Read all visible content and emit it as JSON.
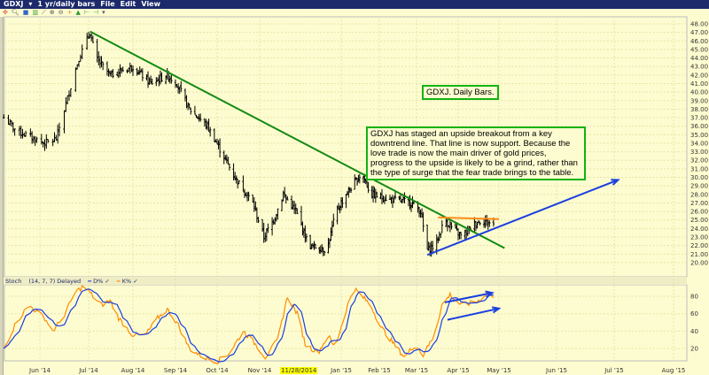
{
  "titlebar": {
    "symbol": "GDXJ",
    "period": "1 yr/daily bars",
    "menu": [
      "File",
      "Edit",
      "View"
    ]
  },
  "notes": {
    "title": "GDXJ. Daily Bars.",
    "comment": "GDXJ has staged an upside breakout from a key downtrend line. That line is now support.  Because the love trade is now the main driver of gold prices, progress to the upside is likely to be a grind, rather than the type of surge that the fear trade brings to the table."
  },
  "stoch_legend": {
    "name": "Stoch",
    "params": "(14, 7, 7) Delayed",
    "d_label": "D%",
    "k_label": "K%"
  },
  "highlight_date": "11/28/2014",
  "colors": {
    "bars": "#000000",
    "downtrend": "#138a13",
    "support": "#1a3ee0",
    "resistance": "#ff8c1a",
    "k": "#ff8c00",
    "d": "#1a3ee0"
  },
  "chart_data": [
    {
      "type": "ohlc",
      "title": "GDXJ daily bars",
      "ylim": [
        20,
        48
      ],
      "yticks": [
        "48.00",
        "47.00",
        "46.00",
        "45.00",
        "44.00",
        "43.00",
        "42.00",
        "41.00",
        "40.00",
        "39.00",
        "38.00",
        "37.00",
        "36.00",
        "35.00",
        "34.00",
        "33.00",
        "32.00",
        "31.00",
        "30.00",
        "29.00",
        "28.00",
        "27.00",
        "26.00",
        "25.00",
        "24.00",
        "23.00",
        "22.00",
        "21.00",
        "20.00"
      ],
      "xticks": [
        "Jun '14",
        "Jul '14",
        "Aug '14",
        "Sep '14",
        "Oct '14",
        "Nov '14",
        "Jan '15",
        "Feb '15",
        "Mar '15",
        "Apr '15",
        "May '15",
        "Jun '15",
        "Jul '15",
        "Aug '15"
      ],
      "close_keypoints": [
        [
          "2014-05-09",
          37
        ],
        [
          "2014-05-17",
          35.5
        ],
        [
          "2014-06-04",
          34
        ],
        [
          "2014-06-11",
          34.5
        ],
        [
          "2014-06-19",
          40
        ],
        [
          "2014-06-25",
          44
        ],
        [
          "2014-07-02",
          47
        ],
        [
          "2014-07-06",
          44
        ],
        [
          "2014-07-16",
          42
        ],
        [
          "2014-08-01",
          43
        ],
        [
          "2014-08-14",
          41
        ],
        [
          "2014-08-26",
          42
        ],
        [
          "2014-09-02",
          41
        ],
        [
          "2014-09-11",
          38
        ],
        [
          "2014-09-24",
          36
        ],
        [
          "2014-10-04",
          33
        ],
        [
          "2014-10-14",
          30
        ],
        [
          "2014-10-27",
          27
        ],
        [
          "2014-11-04",
          23
        ],
        [
          "2014-11-11",
          25
        ],
        [
          "2014-11-18",
          28
        ],
        [
          "2014-11-27",
          26
        ],
        [
          "2014-12-07",
          22
        ],
        [
          "2014-12-21",
          21.5
        ],
        [
          "2014-12-28",
          26
        ],
        [
          "2015-01-05",
          28
        ],
        [
          "2015-01-18",
          30.5
        ],
        [
          "2015-01-25",
          28
        ],
        [
          "2015-02-07",
          27.5
        ],
        [
          "2015-02-26",
          27
        ],
        [
          "2015-03-04",
          26
        ],
        [
          "2015-03-09",
          21.5
        ],
        [
          "2015-03-15",
          22
        ],
        [
          "2015-03-22",
          25
        ],
        [
          "2015-03-28",
          24
        ],
        [
          "2015-04-04",
          23
        ],
        [
          "2015-04-12",
          24.5
        ],
        [
          "2015-04-19",
          25
        ],
        [
          "2015-04-27",
          24.5
        ]
      ],
      "lines": [
        {
          "name": "downtrend",
          "from": [
            "2014-07-02",
            47.1
          ],
          "to": [
            "2015-05-04",
            21.7
          ]
        },
        {
          "name": "support",
          "from": [
            "2015-03-09",
            20.9
          ],
          "to": [
            "2015-07-03",
            29.7
          ],
          "arrow": true
        },
        {
          "name": "resistance",
          "from": [
            "2015-03-17",
            25.3
          ],
          "to": [
            "2015-05-01",
            25.1
          ]
        }
      ]
    },
    {
      "type": "line",
      "title": "Stoch (14, 7, 7) Delayed",
      "ylim": [
        0,
        100
      ],
      "yticks": [
        "80",
        "60",
        "40",
        "20"
      ],
      "series": [
        {
          "name": "K%",
          "keypoints": [
            [
              "2014-05-09",
              20
            ],
            [
              "2014-05-17",
              50
            ],
            [
              "2014-05-25",
              70
            ],
            [
              "2014-06-04",
              55
            ],
            [
              "2014-06-09",
              40
            ],
            [
              "2014-06-15",
              55
            ],
            [
              "2014-06-23",
              85
            ],
            [
              "2014-06-28",
              92
            ],
            [
              "2014-07-04",
              80
            ],
            [
              "2014-07-10",
              70
            ],
            [
              "2014-07-16",
              75
            ],
            [
              "2014-07-22",
              55
            ],
            [
              "2014-08-01",
              35
            ],
            [
              "2014-08-10",
              35
            ],
            [
              "2014-08-19",
              55
            ],
            [
              "2014-08-26",
              65
            ],
            [
              "2014-09-02",
              50
            ],
            [
              "2014-09-11",
              20
            ],
            [
              "2014-09-21",
              10
            ],
            [
              "2014-10-01",
              5
            ],
            [
              "2014-10-10",
              15
            ],
            [
              "2014-10-20",
              40
            ],
            [
              "2014-10-29",
              25
            ],
            [
              "2014-11-05",
              10
            ],
            [
              "2014-11-14",
              30
            ],
            [
              "2014-11-21",
              80
            ],
            [
              "2014-11-28",
              60
            ],
            [
              "2014-12-04",
              25
            ],
            [
              "2014-12-14",
              15
            ],
            [
              "2014-12-22",
              35
            ],
            [
              "2014-12-27",
              20
            ],
            [
              "2015-01-04",
              60
            ],
            [
              "2015-01-11",
              90
            ],
            [
              "2015-01-18",
              80
            ],
            [
              "2015-01-25",
              70
            ],
            [
              "2015-02-02",
              45
            ],
            [
              "2015-02-12",
              25
            ],
            [
              "2015-02-20",
              10
            ],
            [
              "2015-02-28",
              25
            ],
            [
              "2015-03-06",
              12
            ],
            [
              "2015-03-14",
              35
            ],
            [
              "2015-03-20",
              70
            ],
            [
              "2015-03-26",
              82
            ],
            [
              "2015-04-03",
              70
            ],
            [
              "2015-04-10",
              72
            ],
            [
              "2015-04-16",
              75
            ],
            [
              "2015-04-23",
              85
            ],
            [
              "2015-04-27",
              78
            ]
          ]
        },
        {
          "name": "D%",
          "derived": "moving average of K%"
        }
      ],
      "arrows": [
        {
          "from": [
            "2015-03-22",
            73
          ],
          "to": [
            "2015-04-26",
            84
          ]
        },
        {
          "from": [
            "2015-03-24",
            53
          ],
          "to": [
            "2015-05-01",
            66
          ]
        }
      ]
    }
  ]
}
